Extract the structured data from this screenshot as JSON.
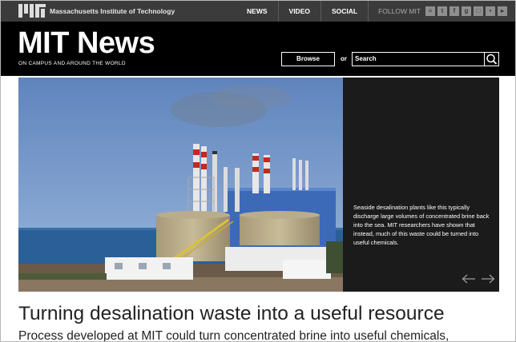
{
  "topbar": {
    "institute_name": "Massachusetts Institute of Technology",
    "nav": [
      "NEWS",
      "VIDEO",
      "SOCIAL"
    ],
    "follow_label": "FOLLOW MIT",
    "social_icons": [
      {
        "name": "rss-icon",
        "glyph": "≡"
      },
      {
        "name": "twitter-icon",
        "glyph": "t"
      },
      {
        "name": "facebook-icon",
        "glyph": "f"
      },
      {
        "name": "google-plus-icon",
        "glyph": "g"
      },
      {
        "name": "instagram-icon",
        "glyph": "□"
      },
      {
        "name": "flickr-icon",
        "glyph": "•"
      },
      {
        "name": "youtube-icon",
        "glyph": "▸"
      }
    ]
  },
  "header": {
    "title": "MIT News",
    "tagline": "ON CAMPUS AND AROUND THE WORLD",
    "browse_label": "Browse",
    "or_label": "or",
    "search_value": "Search"
  },
  "hero": {
    "caption": "Seaside desalination plants like this typically discharge large volumes of concentrated brine back into the sea. MIT researchers have shown that instead, much of this waste could be turned into useful chemicals."
  },
  "article": {
    "headline": "Turning desalination waste into a useful resource",
    "dek": "Process developed at MIT could turn concentrated brine into useful chemicals,"
  },
  "colors": {
    "topbar_bg": "#3b3b3b",
    "header_bg": "#000000",
    "caption_bg": "#1b1b1b"
  }
}
